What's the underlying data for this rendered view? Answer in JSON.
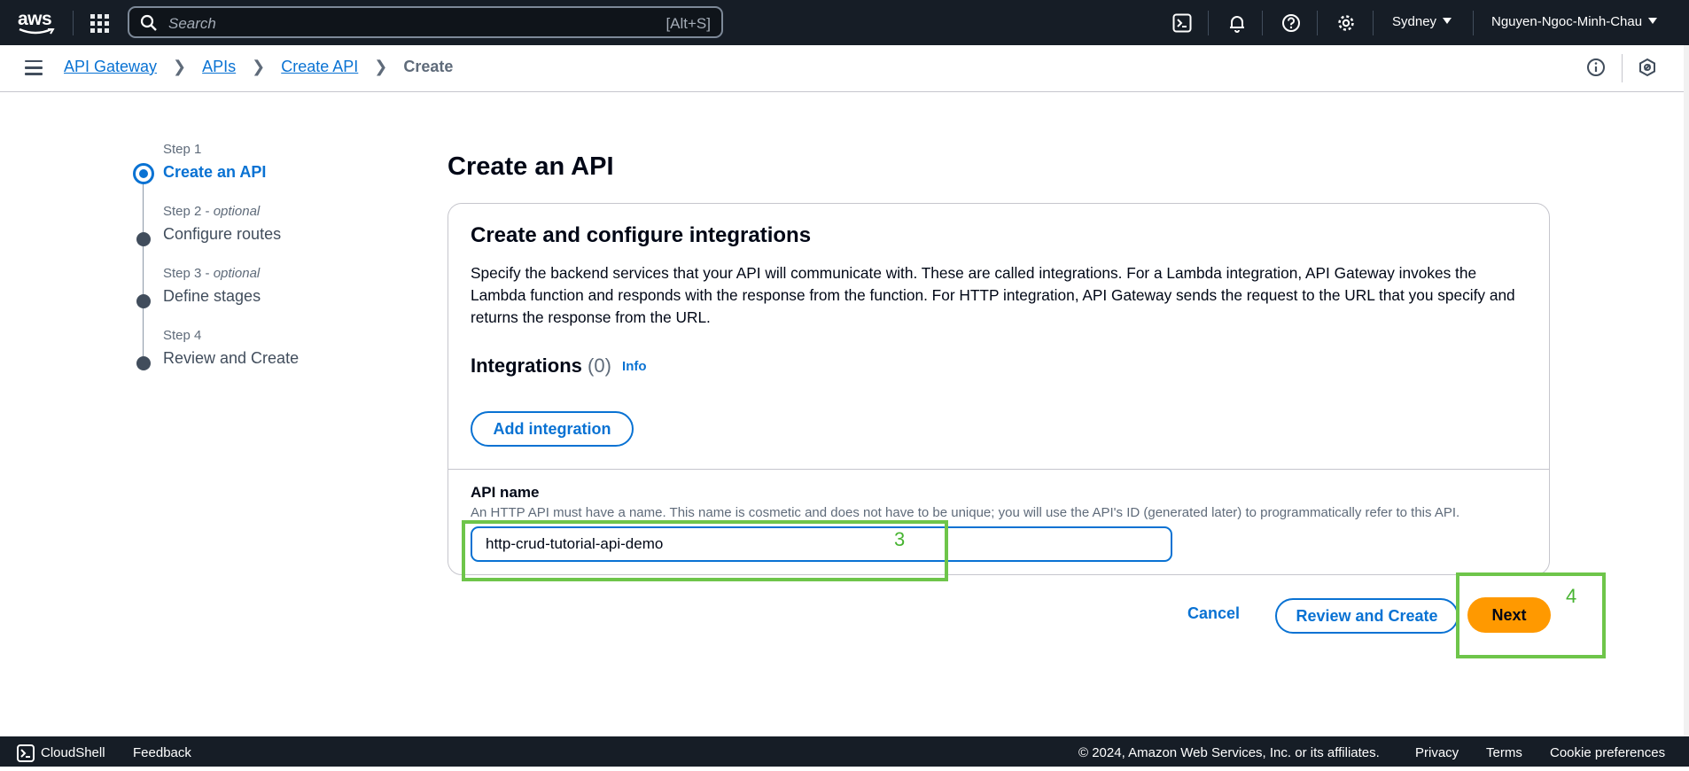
{
  "nav": {
    "logo": "aws",
    "search_placeholder": "Search",
    "search_shortcut": "[Alt+S]",
    "region": "Sydney",
    "user": "Nguyen-Ngoc-Minh-Chau"
  },
  "breadcrumb": {
    "items": [
      "API Gateway",
      "APIs",
      "Create API"
    ],
    "current": "Create"
  },
  "wizard": {
    "steps": [
      {
        "label": "Step 1",
        "optional": "",
        "title": "Create an API"
      },
      {
        "label": "Step 2 - ",
        "optional": "optional",
        "title": "Configure routes"
      },
      {
        "label": "Step 3 - ",
        "optional": "optional",
        "title": "Define stages"
      },
      {
        "label": "Step 4",
        "optional": "",
        "title": "Review and Create"
      }
    ]
  },
  "main": {
    "title": "Create an API",
    "card_title": "Create and configure integrations",
    "card_desc": "Specify the backend services that your API will communicate with. These are called integrations. For a Lambda integration, API Gateway invokes the Lambda function and responds with the response from the function. For HTTP integration, API Gateway sends the request to the URL that you specify and returns the response from the URL.",
    "integrations_title": "Integrations",
    "integrations_count": "(0)",
    "info_link": "Info",
    "add_integration": "Add integration",
    "api_name_label": "API name",
    "api_name_desc": "An HTTP API must have a name. This name is cosmetic and does not have to be unique; you will use the API's ID (generated later) to programmatically refer to this API.",
    "api_name_value": "http-crud-tutorial-api-demo"
  },
  "actions": {
    "cancel": "Cancel",
    "review": "Review and Create",
    "next": "Next"
  },
  "annotations": {
    "a3": "3",
    "a4": "4"
  },
  "footer": {
    "cloudshell": "CloudShell",
    "feedback": "Feedback",
    "copyright": "© 2024, Amazon Web Services, Inc. or its affiliates.",
    "privacy": "Privacy",
    "terms": "Terms",
    "cookies": "Cookie preferences"
  },
  "colors": {
    "accent": "#0972d3",
    "primary_button": "#ff9900",
    "nav_bg": "#161d26",
    "annotation": "#6ec54a"
  }
}
